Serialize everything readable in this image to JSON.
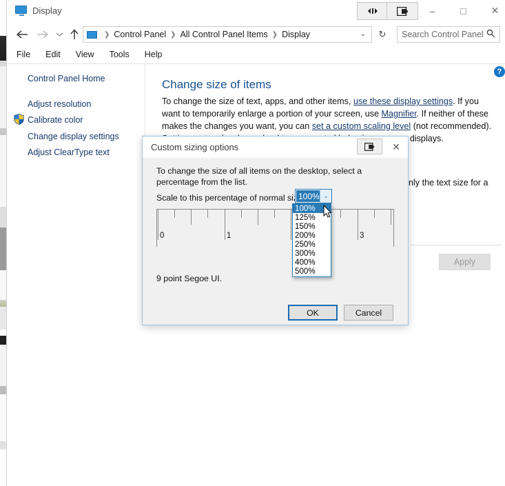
{
  "window": {
    "title": "Display",
    "title_icon": "monitor-icon",
    "buttons": {
      "extra_resize": "resize-arrows-icon",
      "extra_move": "move-to-monitor-icon",
      "minimize": "–",
      "maximize": "□",
      "close": "✕"
    }
  },
  "navbar": {
    "back": "←",
    "forward": "→",
    "recent": "⌄",
    "up": "↑",
    "breadcrumbs": [
      "Control Panel",
      "All Control Panel Items",
      "Display"
    ],
    "separator": "❯",
    "address_chevron": "⌄",
    "refresh": "↻",
    "search_placeholder": "Search Control Panel",
    "search_icon": "magnifier-icon"
  },
  "menubar": {
    "items": [
      "File",
      "Edit",
      "View",
      "Tools",
      "Help"
    ]
  },
  "taskpane": {
    "home": "Control Panel Home",
    "items": [
      "Adjust resolution",
      "Calibrate color",
      "Change display settings",
      "Adjust ClearType text"
    ],
    "shield_icon": "uac-shield-icon"
  },
  "content": {
    "help_icon_label": "?",
    "heading": "Change size of items",
    "body": {
      "p1": "To change the size of text, apps, and other items, ",
      "link1": "use these display settings",
      "p2": ".  If you want to temporarily enlarge a portion of your screen, use ",
      "link2": "Magnifier",
      "p3": ".  If neither of these makes the changes you want, you can ",
      "link3": "set a custom scaling level",
      "p4": " (not recommended).  Setting custom levels can lead to unexpected behavior on some displays."
    },
    "tail_text": "nly the text size for a",
    "apply_button": "Apply"
  },
  "dialog": {
    "title": "Custom sizing options",
    "restore_icon": "move-to-monitor-icon",
    "close_icon": "✕",
    "instructions": "To change the size of all items on the desktop, select a percentage from the list.",
    "scale_label": "Scale to this percentage of normal size:",
    "combo": {
      "value": "100%",
      "chevron": "⌄"
    },
    "ruler": {
      "labels": [
        "0",
        "1",
        "3"
      ],
      "label_positions": [
        0,
        1,
        3
      ],
      "major_ticks": [
        0,
        1,
        2,
        3
      ],
      "units_visible": 3.6
    },
    "sample_text": "9 point Segoe UI.",
    "buttons": {
      "ok": "OK",
      "cancel": "Cancel"
    }
  },
  "dropdown": {
    "selected_index": 0,
    "options": [
      "100%",
      "125%",
      "150%",
      "200%",
      "250%",
      "300%",
      "400%",
      "500%"
    ]
  },
  "colors": {
    "accent": "#2a7ab5",
    "link": "#16396b",
    "heading": "#16508f",
    "dialog_bg": "#f0f0f0",
    "focus_border": "#1a6ab3"
  }
}
